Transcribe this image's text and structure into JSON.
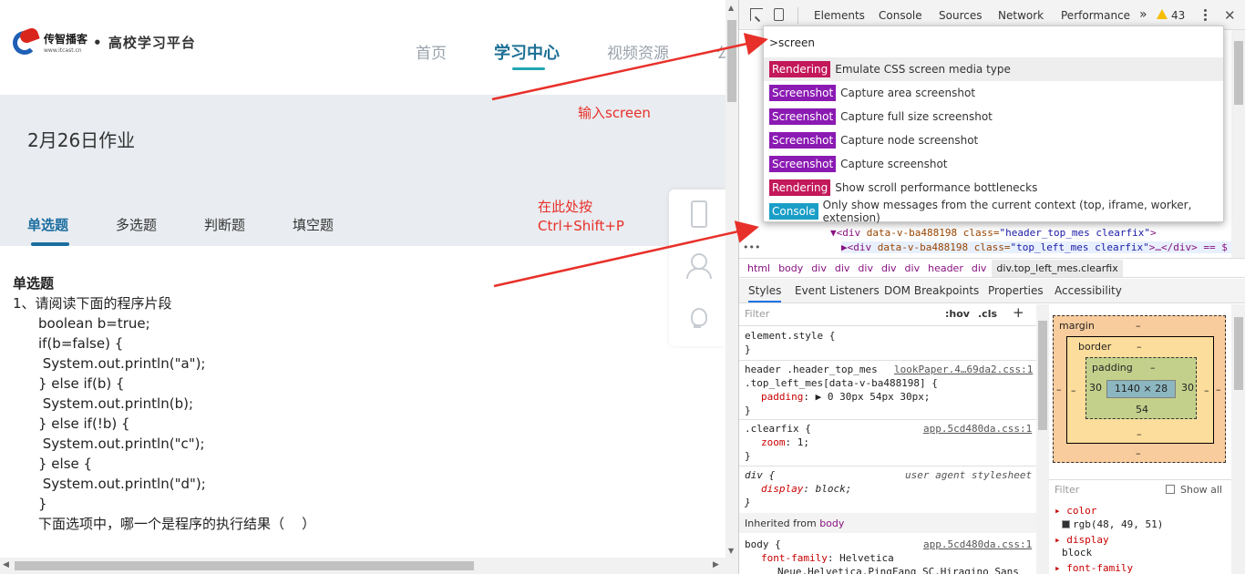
{
  "site": {
    "logo_brand": "传智播客",
    "logo_url": "www.itcast.cn",
    "logo_subtitle": "• 高校学习平台",
    "nav": [
      "首页",
      "学习中心",
      "视频资源",
      "公"
    ]
  },
  "homework": {
    "title": "2月26日作业",
    "tabs": [
      "单选题",
      "多选题",
      "判断题",
      "填空题"
    ],
    "section": "单选题",
    "question_lines": [
      "1、请阅读下面的程序片段",
      "boolean b=true;",
      "if(b=false) {",
      " System.out.println(\"a\");",
      "} else if(b) {",
      " System.out.println(b);",
      "} else if(!b) {",
      " System.out.println(\"c\");",
      "} else {",
      " System.out.println(\"d\");",
      "}",
      "下面选项中，哪一个是程序的执行结果（    ）"
    ]
  },
  "annotations": {
    "note1": "输入screen",
    "note2_line1": "在此处按",
    "note2_line2": "Ctrl+Shift+P",
    "color": "#e8302a"
  },
  "devtools": {
    "tabs": [
      "Elements",
      "Console",
      "Sources",
      "Network",
      "Performance"
    ],
    "more": "»",
    "warning_count": "43",
    "command_input": ">screen",
    "commands": [
      {
        "badge": "Rendering",
        "kind": "rendering",
        "text": "Emulate CSS screen media type"
      },
      {
        "badge": "Screenshot",
        "kind": "screenshot",
        "text": "Capture area screenshot"
      },
      {
        "badge": "Screenshot",
        "kind": "screenshot",
        "text": "Capture full size screenshot"
      },
      {
        "badge": "Screenshot",
        "kind": "screenshot",
        "text": "Capture node screenshot"
      },
      {
        "badge": "Screenshot",
        "kind": "screenshot",
        "text": "Capture screenshot"
      },
      {
        "badge": "Rendering",
        "kind": "rendering",
        "text": "Show scroll performance bottlenecks"
      },
      {
        "badge": "Console",
        "kind": "console",
        "text": "Only show messages from the current context (top, iframe, worker, extension)"
      }
    ],
    "element_lines": [
      {
        "tag_open": "▼<div ",
        "attr1": "data-v-ba488198",
        "attr2": " class=",
        "val": "\"header_top_mes clearfix\"",
        "tail": ">"
      },
      {
        "tag_open": "▶<div ",
        "attr1": "data-v-ba488198",
        "attr2": " class=",
        "val": "\"top_left_mes clearfix\"",
        "tail": ">…</div> == $"
      }
    ],
    "breadcrumb": [
      "html",
      "body",
      "div",
      "div",
      "div",
      "div",
      "div",
      "header",
      "div",
      "div.top_left_mes.clearfix"
    ],
    "sub_tabs": [
      "Styles",
      "Event Listeners",
      "DOM Breakpoints",
      "Properties",
      "Accessibility"
    ],
    "styles": {
      "filter_placeholder": "Filter",
      "hov": ":hov",
      "cls": ".cls",
      "element_style": "element.style {",
      "rule1_sel1": "header .header_top_mes",
      "rule1_sel2": ".top_left_mes[data-v-ba488198] {",
      "rule1_src": "lookPaper.4…69da2.css:1",
      "rule1_prop": "padding",
      "rule1_val": ": ▶ 0 30px 54px 30px;",
      "rule2_sel": ".clearfix {",
      "rule2_src": "app.5cd480da.css:1",
      "rule2_prop": "zoom",
      "rule2_val": ": 1;",
      "rule3_sel": "div {",
      "rule3_src": "user agent stylesheet",
      "rule3_prop": "display",
      "rule3_val": ": block;",
      "close": "}",
      "inherited_label": "Inherited from",
      "inherited_from": "body",
      "rule4_sel": "body {",
      "rule4_src": "app.5cd480da.css:1",
      "rule4_prop": "font-family",
      "rule4_val": ": Helvetica",
      "rule4_cont": "Neue,Helvetica,PingFang SC,Hiragino Sans"
    },
    "box_model": {
      "margin_label": "margin",
      "margin_val": "–",
      "border_label": "border",
      "border_val": "–",
      "padding_label": "padding",
      "padding_val": "–",
      "content": "1140 × 28",
      "padding_left": "30",
      "padding_right": "30",
      "padding_bottom": "54"
    },
    "computed": {
      "filter_placeholder": "Filter",
      "show_all": "Show all",
      "props": [
        {
          "name": "color",
          "value": "rgb(48, 49, 51)"
        },
        {
          "name": "display",
          "value": "block"
        },
        {
          "name": "font-family",
          "value": ""
        }
      ],
      "swatch_color": "#303133"
    }
  }
}
